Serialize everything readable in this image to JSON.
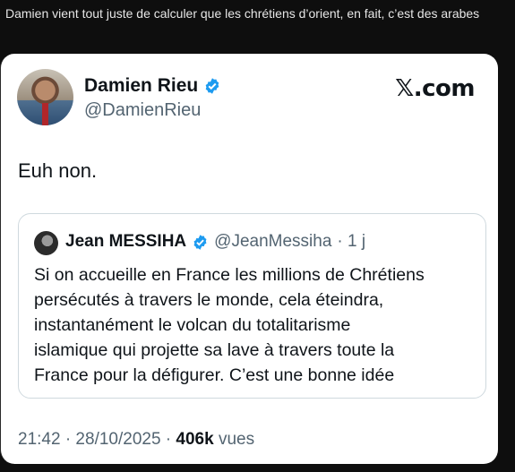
{
  "caption": "Damien vient tout juste de calculer que les chrétiens d’orient, en fait, c’est des arabes",
  "tweet": {
    "author_name": "Damien Rieu",
    "author_handle": "@DamienRieu",
    "brand": "𝕏.com",
    "text": "Euh non.",
    "timestamp": "21:42 · 28/10/2025 ·",
    "views_count": "406k",
    "views_label": "vues",
    "verified_color": "#1d9bf0"
  },
  "quoted": {
    "author_name": "Jean MESSIHA",
    "author_handle": "@JeanMessiha",
    "age": "· 1 j",
    "lines": [
      "Si on accueille en France les millions de Chrétiens",
      "persécutés à travers le monde, cela éteindra,",
      "instantanément le volcan du totalitarisme",
      "islamique qui projette sa lave à travers toute la",
      "France pour la défigurer. C’est une bonne idée"
    ]
  }
}
